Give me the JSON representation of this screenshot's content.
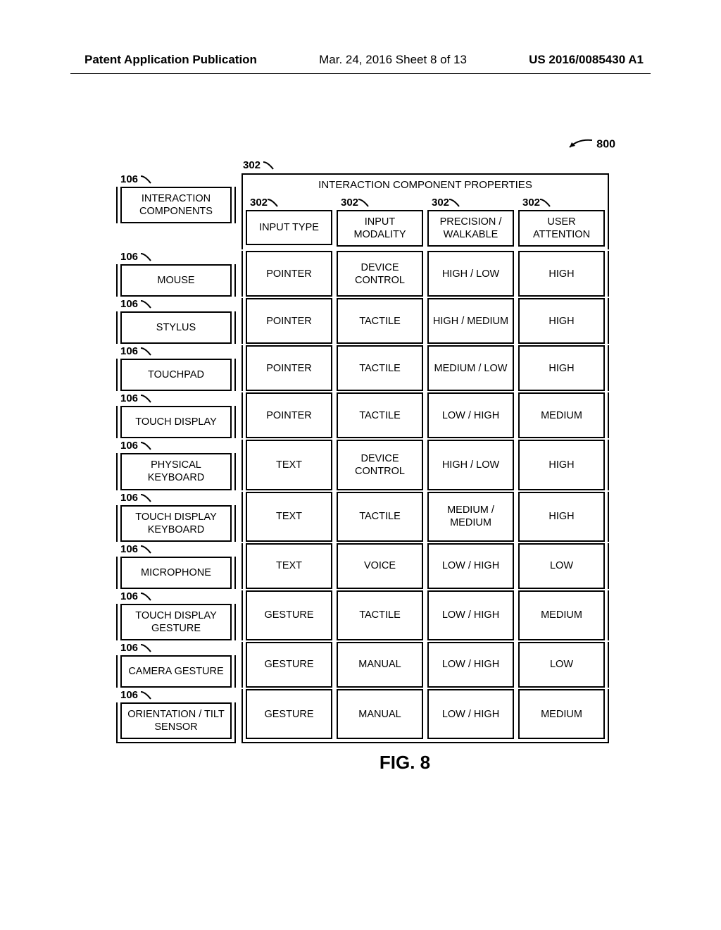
{
  "header": {
    "left": "Patent Application Publication",
    "mid": "Mar. 24, 2016  Sheet 8 of 13",
    "right": "US 2016/0085430 A1"
  },
  "refs": {
    "fig": "800",
    "props": "302",
    "comp": "106"
  },
  "labels": {
    "interaction_components": "INTERACTION COMPONENTS",
    "properties_title": "INTERACTION COMPONENT PROPERTIES",
    "col1": "INPUT TYPE",
    "col2": "INPUT MODALITY",
    "col3": "PRECISION / WALKABLE",
    "col4": "USER ATTENTION"
  },
  "rows": [
    {
      "name": "MOUSE",
      "c1": "POINTER",
      "c2": "DEVICE CONTROL",
      "c3": "HIGH / LOW",
      "c4": "HIGH"
    },
    {
      "name": "STYLUS",
      "c1": "POINTER",
      "c2": "TACTILE",
      "c3": "HIGH / MEDIUM",
      "c4": "HIGH"
    },
    {
      "name": "TOUCHPAD",
      "c1": "POINTER",
      "c2": "TACTILE",
      "c3": "MEDIUM / LOW",
      "c4": "HIGH"
    },
    {
      "name": "TOUCH DISPLAY",
      "c1": "POINTER",
      "c2": "TACTILE",
      "c3": "LOW / HIGH",
      "c4": "MEDIUM"
    },
    {
      "name": "PHYSICAL KEYBOARD",
      "c1": "TEXT",
      "c2": "DEVICE CONTROL",
      "c3": "HIGH / LOW",
      "c4": "HIGH"
    },
    {
      "name": "TOUCH DISPLAY KEYBOARD",
      "c1": "TEXT",
      "c2": "TACTILE",
      "c3": "MEDIUM / MEDIUM",
      "c4": "HIGH"
    },
    {
      "name": "MICROPHONE",
      "c1": "TEXT",
      "c2": "VOICE",
      "c3": "LOW / HIGH",
      "c4": "LOW"
    },
    {
      "name": "TOUCH DISPLAY GESTURE",
      "c1": "GESTURE",
      "c2": "TACTILE",
      "c3": "LOW / HIGH",
      "c4": "MEDIUM"
    },
    {
      "name": "CAMERA GESTURE",
      "c1": "GESTURE",
      "c2": "MANUAL",
      "c3": "LOW / HIGH",
      "c4": "LOW"
    },
    {
      "name": "ORIENTATION / TILT SENSOR",
      "c1": "GESTURE",
      "c2": "MANUAL",
      "c3": "LOW / HIGH",
      "c4": "MEDIUM"
    }
  ],
  "caption": "FIG. 8"
}
